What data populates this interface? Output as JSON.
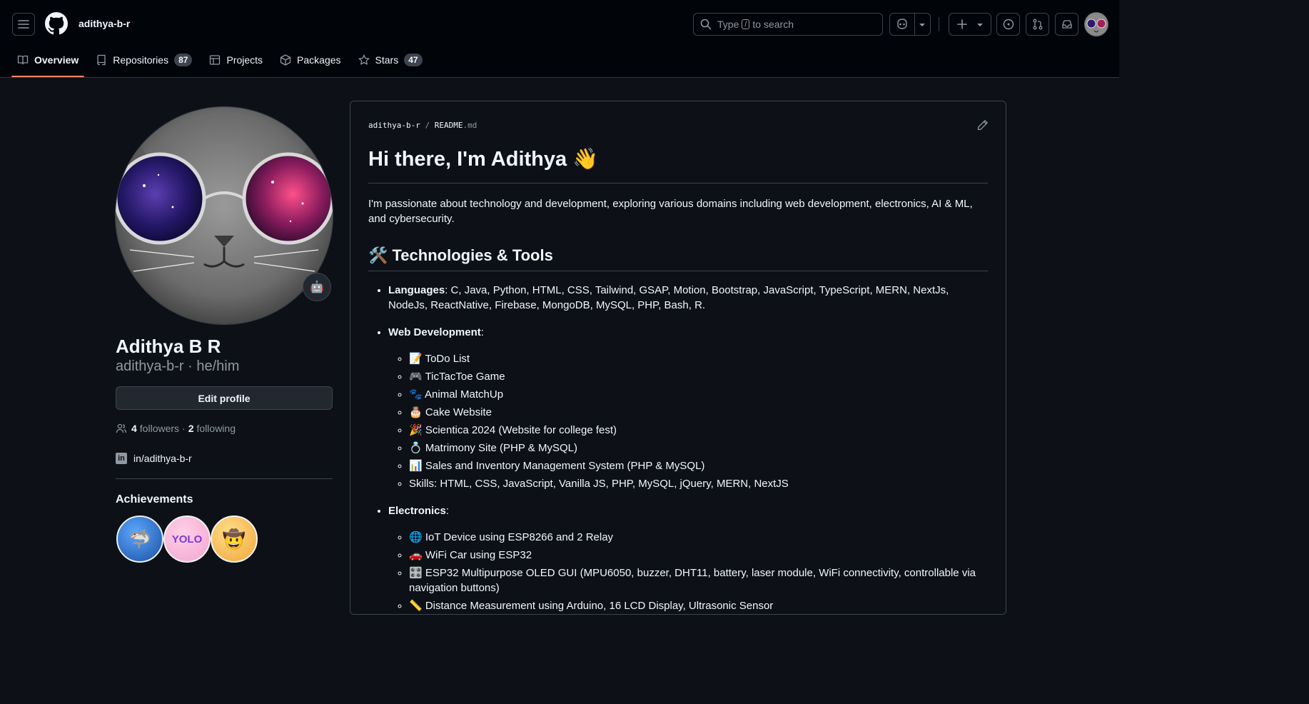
{
  "header": {
    "username": "adithya-b-r",
    "search_prefix": "Type",
    "search_key": "/",
    "search_suffix": "to search"
  },
  "tabs": [
    {
      "label": "Overview",
      "selected": true
    },
    {
      "label": "Repositories",
      "count": "87"
    },
    {
      "label": "Projects"
    },
    {
      "label": "Packages"
    },
    {
      "label": "Stars",
      "count": "47"
    }
  ],
  "profile": {
    "name": "Adithya B R",
    "login_line": "adithya-b-r · he/him",
    "edit_label": "Edit profile",
    "followers_count": "4",
    "followers_label": "followers",
    "separator": "·",
    "following_count": "2",
    "following_label": "following",
    "linkedin": "in/adithya-b-r",
    "achievements_title": "Achievements"
  },
  "readme": {
    "path_user": "adithya-b-r",
    "path_sep": "/",
    "path_file": "README",
    "path_ext": ".md",
    "heading": "Hi there, I'm Adithya 👋",
    "intro": "I'm passionate about technology and development, exploring various domains including web development, electronics, AI & ML, and cybersecurity.",
    "tools_heading": "🛠️ Technologies & Tools",
    "languages_label": "Languages",
    "languages_text": ": C, Java, Python, HTML, CSS, Tailwind, GSAP, Motion, Bootstrap, JavaScript, TypeScript, MERN, NextJs, NodeJs, ReactNative, Firebase, MongoDB, MySQL, PHP, Bash, R.",
    "web_label": "Web Development",
    "web_colon": ":",
    "web_items": [
      "📝 ToDo List",
      "🎮 TicTacToe Game",
      "🐾 Animal MatchUp",
      "🎂 Cake Website",
      "🎉 Scientica 2024 (Website for college fest)",
      "💍 Matrimony Site (PHP & MySQL)",
      "📊 Sales and Inventory Management System (PHP & MySQL)",
      "Skills: HTML, CSS, JavaScript, Vanilla JS, PHP, MySQL, jQuery, MERN, NextJS"
    ],
    "elec_label": "Electronics",
    "elec_colon": ":",
    "elec_items": [
      "🌐 IoT Device using ESP8266 and 2 Relay",
      "🚗 WiFi Car using ESP32",
      "🎛️ ESP32 Multipurpose OLED GUI (MPU6050, buzzer, DHT11, battery, laser module, WiFi connectivity, controllable via navigation buttons)",
      "📏 Distance Measurement using Arduino, 16 LCD Display, Ultrasonic Sensor"
    ]
  }
}
